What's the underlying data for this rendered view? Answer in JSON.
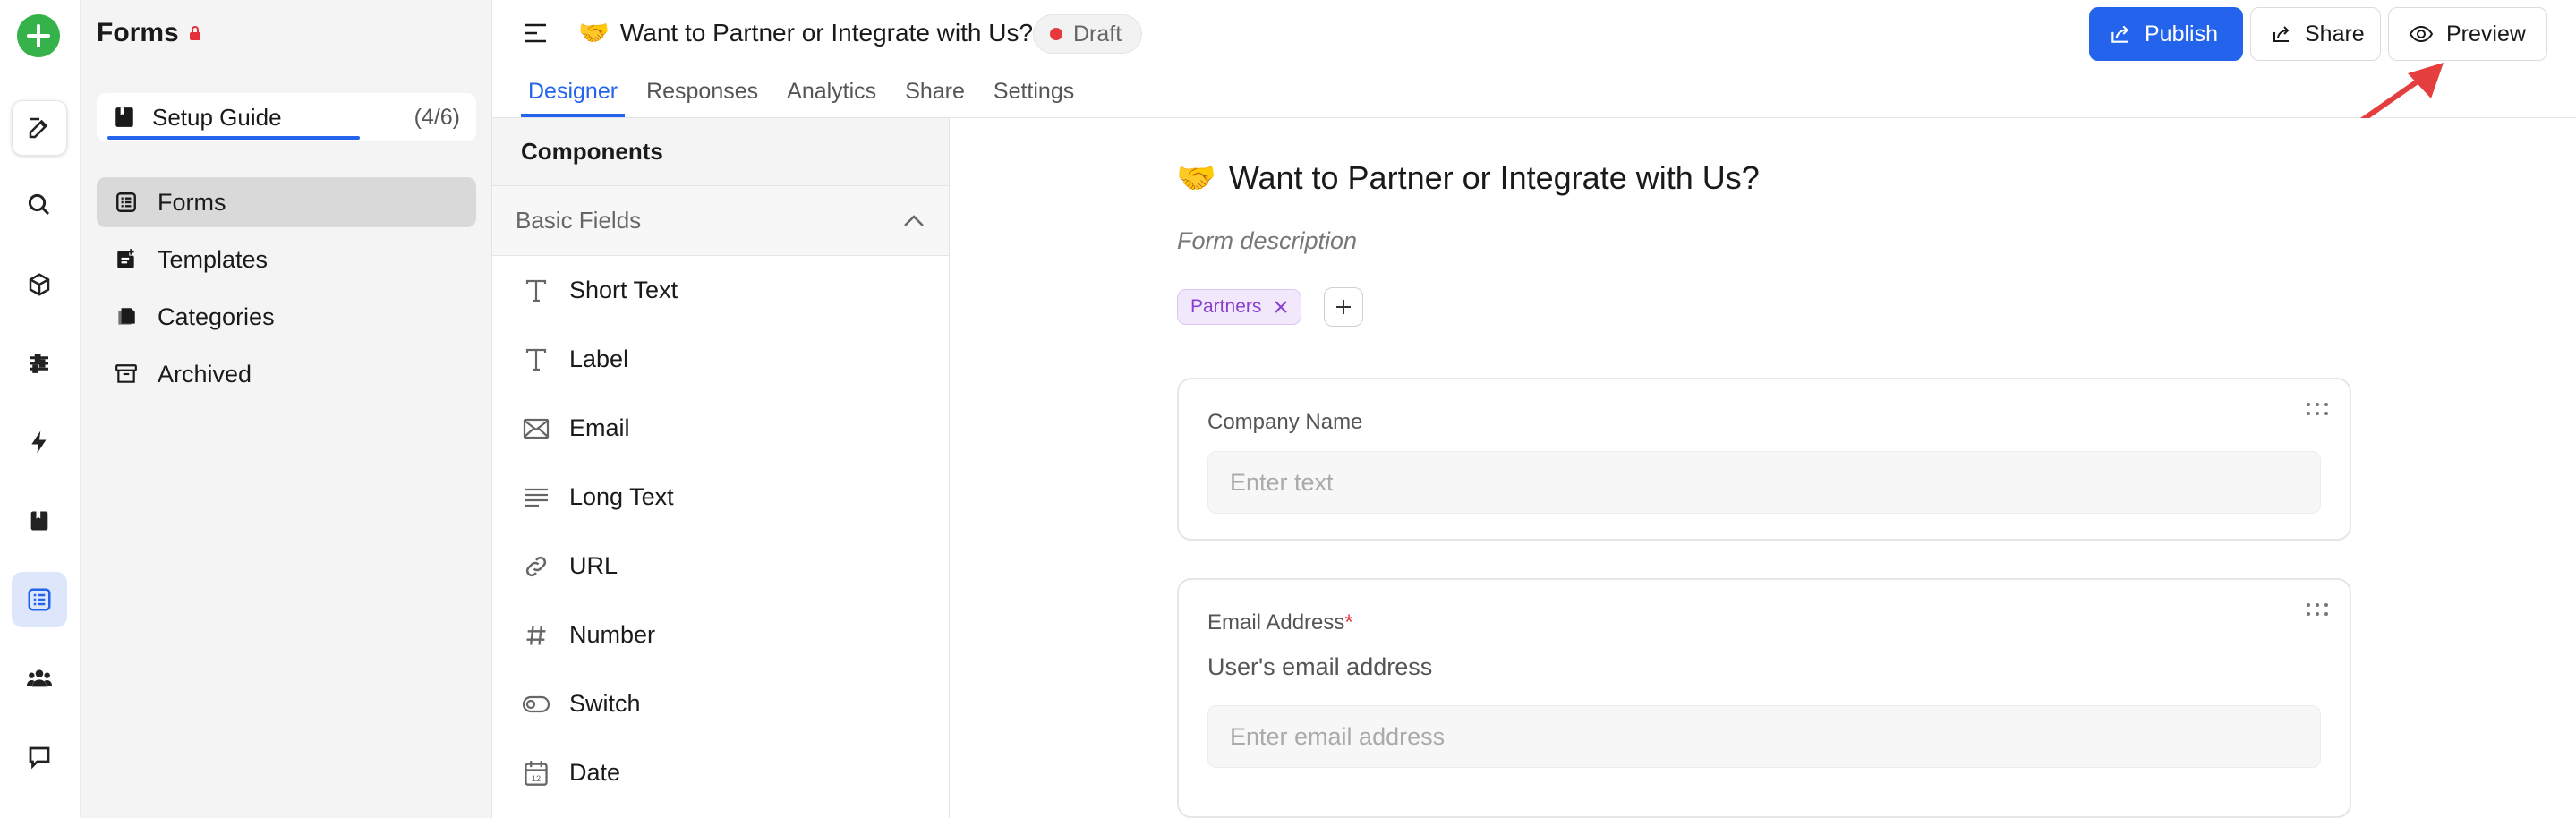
{
  "sidebar": {
    "title": "Forms",
    "setup_guide": {
      "label": "Setup Guide",
      "progress": "(4/6)"
    },
    "items": [
      {
        "label": "Forms",
        "icon": "forms-list-icon",
        "active": true
      },
      {
        "label": "Templates",
        "icon": "templates-icon",
        "active": false
      },
      {
        "label": "Categories",
        "icon": "categories-icon",
        "active": false
      },
      {
        "label": "Archived",
        "icon": "archive-box-icon",
        "active": false
      }
    ]
  },
  "header": {
    "form_emoji": "🤝",
    "form_title": "Want to Partner or Integrate with Us?",
    "status": "Draft",
    "tabs": [
      "Designer",
      "Responses",
      "Analytics",
      "Share",
      "Settings"
    ],
    "active_tab": "Designer",
    "publish_label": "Publish",
    "share_label": "Share",
    "preview_label": "Preview"
  },
  "components": {
    "title": "Components",
    "section": "Basic Fields",
    "items": [
      {
        "label": "Short Text",
        "icon": "text-t-icon"
      },
      {
        "label": "Label",
        "icon": "text-t-icon"
      },
      {
        "label": "Email",
        "icon": "envelope-icon"
      },
      {
        "label": "Long Text",
        "icon": "long-text-lines-icon"
      },
      {
        "label": "URL",
        "icon": "link-icon"
      },
      {
        "label": "Number",
        "icon": "hash-icon"
      },
      {
        "label": "Switch",
        "icon": "toggle-icon"
      },
      {
        "label": "Date",
        "icon": "calendar-icon"
      }
    ]
  },
  "canvas": {
    "heading_emoji": "🤝",
    "heading": "Want to Partner or Integrate with Us?",
    "description_placeholder": "Form description",
    "tag": "Partners",
    "fields": [
      {
        "label": "Company Name",
        "required": false,
        "required_mark": "",
        "help": "",
        "placeholder": "Enter text"
      },
      {
        "label": "Email Address",
        "required": true,
        "required_mark": "*",
        "help": "User's email address",
        "placeholder": "Enter email address"
      }
    ]
  },
  "colors": {
    "accent": "#2463eb",
    "brand_green": "#35b24a",
    "draft_dot": "#e5393b",
    "tag_purple": "#8a3fd0",
    "annotation_arrow": "#e53e3e"
  }
}
